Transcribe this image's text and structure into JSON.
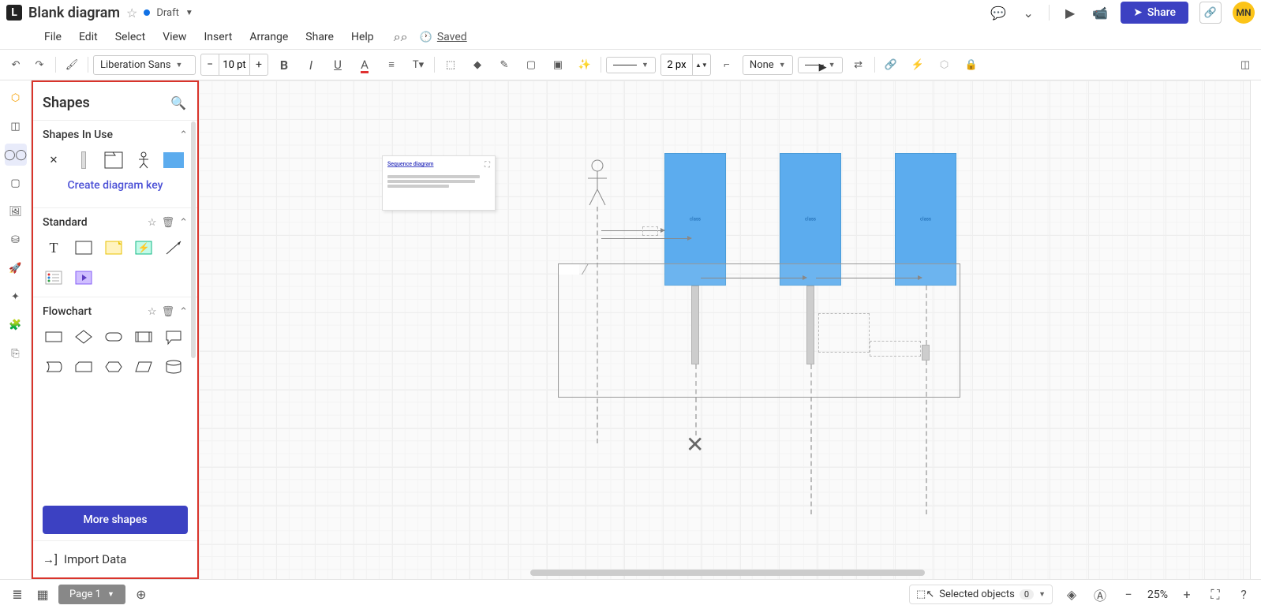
{
  "header": {
    "doc_name": "Blank diagram",
    "status": "Draft",
    "avatar": "MN",
    "share": "Share"
  },
  "menu": {
    "items": [
      "File",
      "Edit",
      "Select",
      "View",
      "Insert",
      "Arrange",
      "Share",
      "Help"
    ],
    "saved": "Saved"
  },
  "toolbar": {
    "font": "Liberation Sans",
    "size": "10 pt",
    "stroke_width": "2 px",
    "arrow_start": "None"
  },
  "shapes_panel": {
    "title": "Shapes",
    "sections": {
      "inuse": "Shapes In Use",
      "standard": "Standard",
      "flowchart": "Flowchart"
    },
    "create_key": "Create diagram key",
    "more_shapes": "More shapes",
    "import_data": "Import Data"
  },
  "canvas": {
    "note_title": "Sequence diagram",
    "block_labels": [
      "class",
      "class",
      "class"
    ]
  },
  "footer": {
    "page": "Page 1",
    "selected_label": "Selected objects",
    "selected_count": "0",
    "zoom": "25%"
  }
}
